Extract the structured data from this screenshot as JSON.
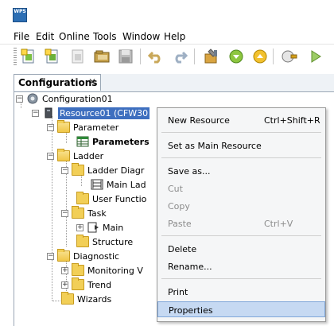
{
  "app": {
    "logo_text": "WPS"
  },
  "menubar": [
    "File",
    "Edit",
    "Online",
    "Tools",
    "Window",
    "Help"
  ],
  "toolbar": {
    "icons": [
      "new-project-icon",
      "new-item-icon",
      "new-disabled-icon",
      "open-folder-icon",
      "save-icon",
      "undo-icon",
      "redo-icon",
      "build-icon",
      "download-icon",
      "upload-icon",
      "online-icon",
      "run-icon"
    ]
  },
  "tab": {
    "label": "Configurations",
    "close": "✕"
  },
  "tree": {
    "configuration": "Configuration01",
    "resource": "Resource01 (CFW30",
    "parameter": "Parameter",
    "parameters": "Parameters",
    "ladder": "Ladder",
    "ladder_diagram": "Ladder Diagr",
    "main_ladder": "Main Lad",
    "user_functions": "User Functio",
    "task": "Task",
    "main": "Main",
    "structure": "Structure",
    "diagnostic": "Diagnostic",
    "monitoring": "Monitoring V",
    "trend": "Trend",
    "wizards": "Wizards"
  },
  "context_menu": {
    "new_resource": "New Resource",
    "new_resource_shortcut": "Ctrl+Shift+R",
    "set_main": "Set as Main Resource",
    "save_as": "Save as...",
    "cut": "Cut",
    "copy": "Copy",
    "paste": "Paste",
    "paste_shortcut": "Ctrl+V",
    "delete": "Delete",
    "rename": "Rename...",
    "print": "Print",
    "properties": "Properties"
  },
  "colors": {
    "selection": "#3e6fbf",
    "menu_hover": "#c6d9f2",
    "folder": "#f2cf57"
  }
}
